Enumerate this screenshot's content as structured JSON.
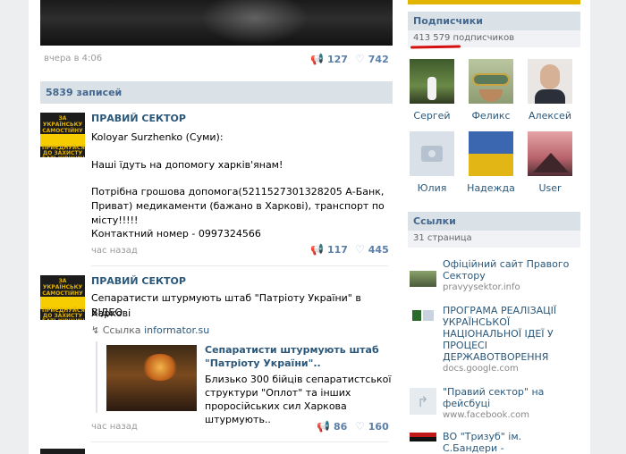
{
  "post0": {
    "time": "вчера в 4:06",
    "shares": "127",
    "likes": "742"
  },
  "wall": {
    "count_label": "5839 записей"
  },
  "post1": {
    "author": "ПРАВИЙ СЕКТОР",
    "line1": "Koloyar Surzhenko (Суми):",
    "line2": "Наші їдуть на допомогу харків'янам!",
    "line3": "Потрібна грошова допомога(5211527301328205 А-Банк,",
    "line4": "Приват) медикаменти (бажано в Харкові), транспорт по",
    "line5": "місту!!!!!",
    "line6": "Контактний номер - 0997324566",
    "time": "час назад",
    "shares": "117",
    "likes": "445"
  },
  "post2": {
    "author": "ПРАВИЙ СЕКТОР",
    "line1": "Сепаратисти штурмують штаб \"Патріоту України\" в Харкові",
    "line2": "ВІДЕО",
    "link_prefix": "Ссылка",
    "link_domain": "informator.su",
    "attach_title": "Сепаратисти штурмують штаб \"Патріоту України\"..",
    "attach_desc": "Близько 300 бійців сепаратистської структури \"Оплот\" та інших проросійських сил Харкова штурмують..",
    "time": "час назад",
    "shares": "86",
    "likes": "160"
  },
  "avatar_text": {
    "top": "ЗА УКРАЇНСЬКУ САМОСТІЙНУ СОБОРНУ ДЕРЖАВУ!",
    "bottom": "ПРИЄДНУЙСЯ ДО ЗАХИСТУ БАТЬКІВЩИНИ!"
  },
  "subscribers": {
    "title": "Подписчики",
    "count": "413 579 подписчиков",
    "people": [
      {
        "name": "Сергей"
      },
      {
        "name": "Феликс"
      },
      {
        "name": "Алексей"
      },
      {
        "name": "Юлия"
      },
      {
        "name": "Надежда"
      },
      {
        "name": "User"
      }
    ]
  },
  "links": {
    "title": "Ссылки",
    "count": "31 страница",
    "items": [
      {
        "title": "Офіційний сайт Правого Сектору",
        "domain": "pravyysektor.info"
      },
      {
        "title": "ПРОГРАМА РЕАЛІЗАЦІЇ УКРАЇНСЬКОЇ НАЦІОНАЛЬНОЇ ІДЕЇ У ПРОЦЕСІ ДЕРЖАВОТВОРЕННЯ",
        "domain": "docs.google.com"
      },
      {
        "title": "\"Правий сектор\" на фейсбуці",
        "domain": "www.facebook.com"
      },
      {
        "title": "ВО \"Тризуб\" ім. С.Бандери - \"Бандерівець\"",
        "domain": ""
      }
    ]
  },
  "colors": {
    "link": "#2b587a",
    "header_bg": "#dae2e8",
    "accent_red": "#d41010"
  }
}
